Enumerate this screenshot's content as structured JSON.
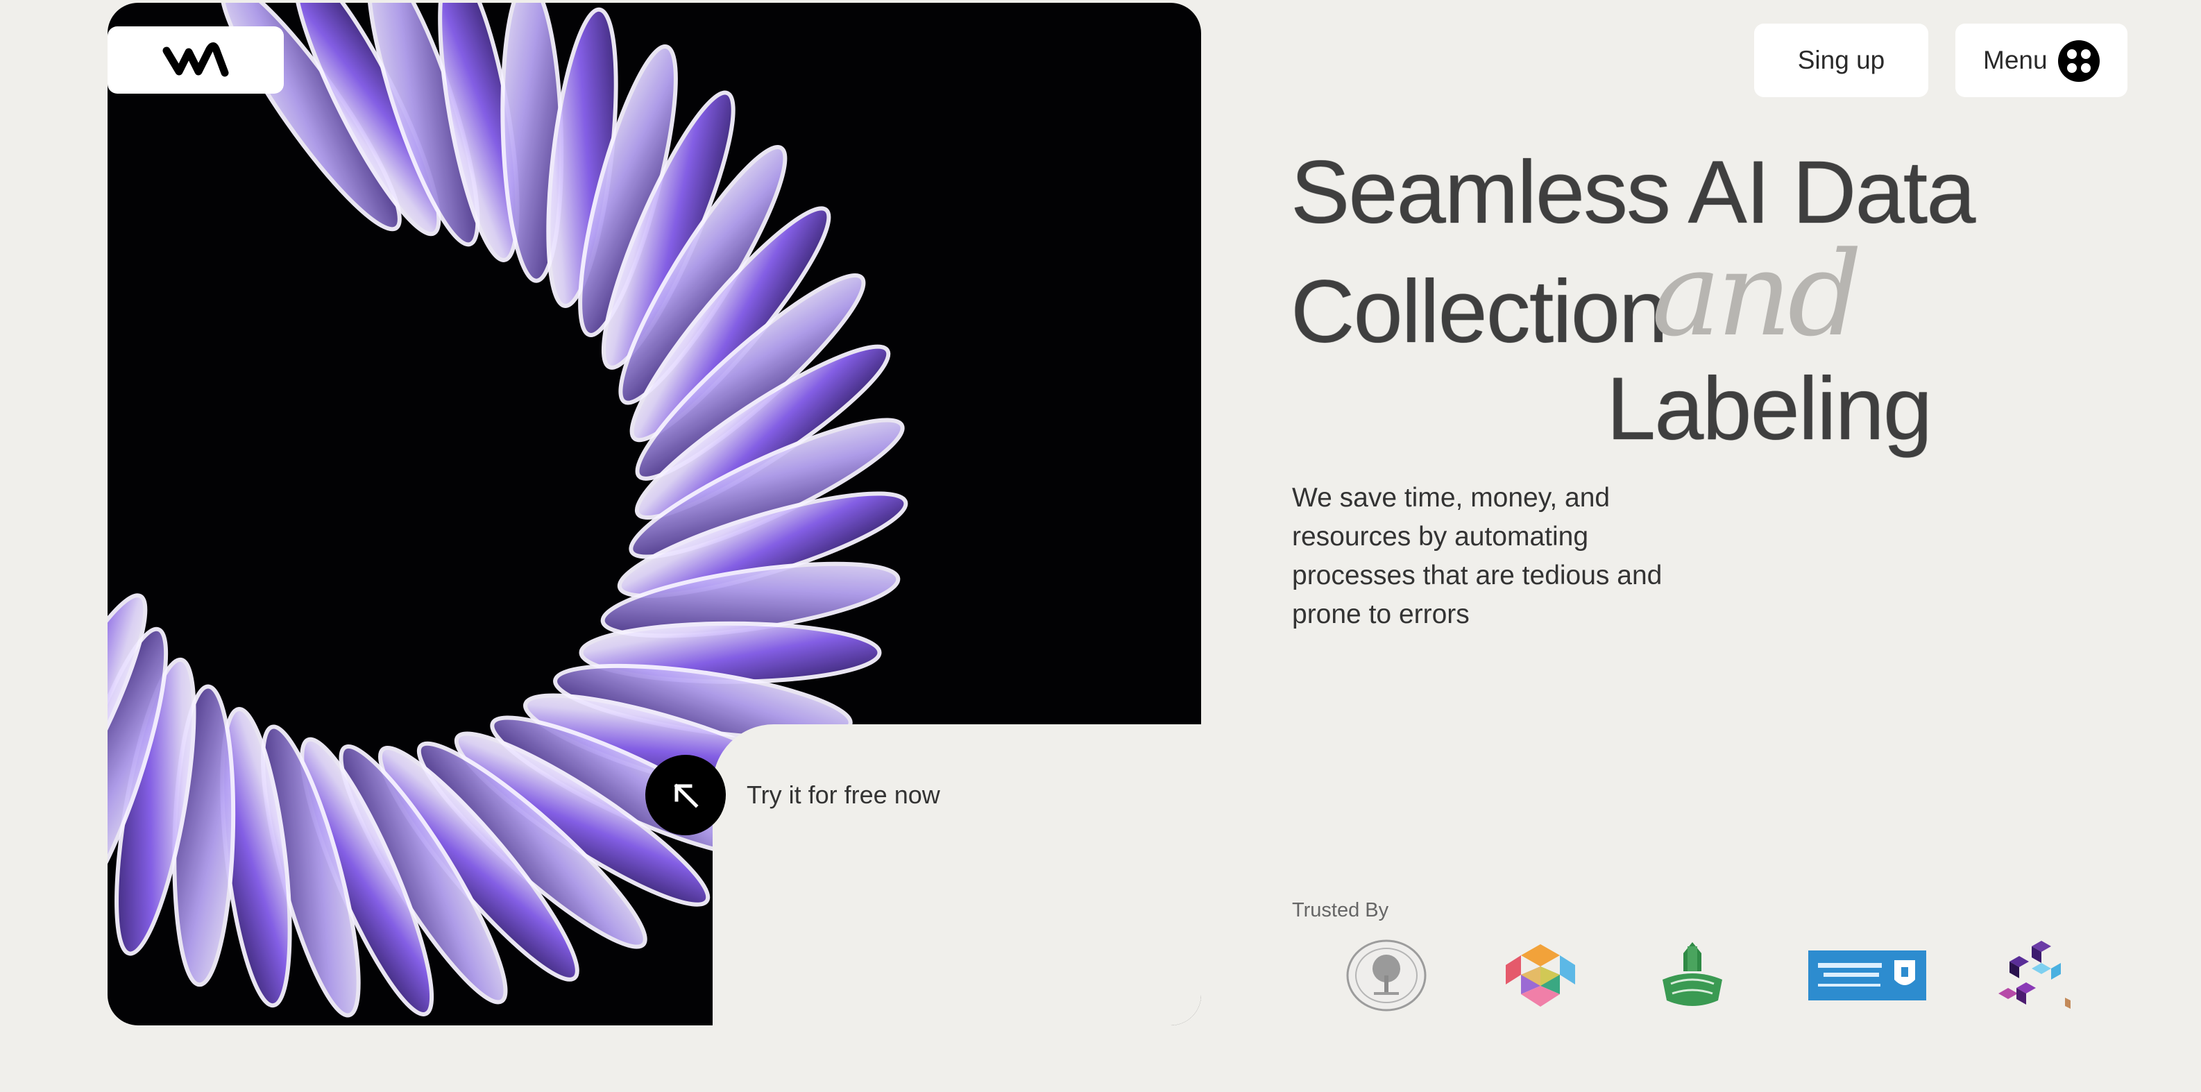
{
  "header": {
    "logo_icon": "wave-logo-icon",
    "signup_label": "Sing up",
    "menu_label": "Menu",
    "menu_icon": "four-dots-icon"
  },
  "hero": {
    "headline_line1": "Seamless AI Data",
    "headline_line2": "Collection",
    "headline_and": "and",
    "headline_line3": "Labeling",
    "subtitle": "We save time, money, and resources by automating processes that are tedious and prone to errors",
    "cta_label": "Try it for free now",
    "cta_icon": "arrow-up-left-icon"
  },
  "trusted": {
    "label": "Trusted By",
    "logos": [
      {
        "name": "tree-seal-logo"
      },
      {
        "name": "hexagon-mosaic-logo"
      },
      {
        "name": "green-crest-logo"
      },
      {
        "name": "king-saud-university-logo"
      },
      {
        "name": "purple-cubes-logo"
      }
    ]
  },
  "colors": {
    "background": "#f0efeb",
    "hero_black": "#020204",
    "accent_purple": "#7b57e6",
    "text_dark": "#3f3f3f",
    "and_gray": "#b7b5b1"
  }
}
